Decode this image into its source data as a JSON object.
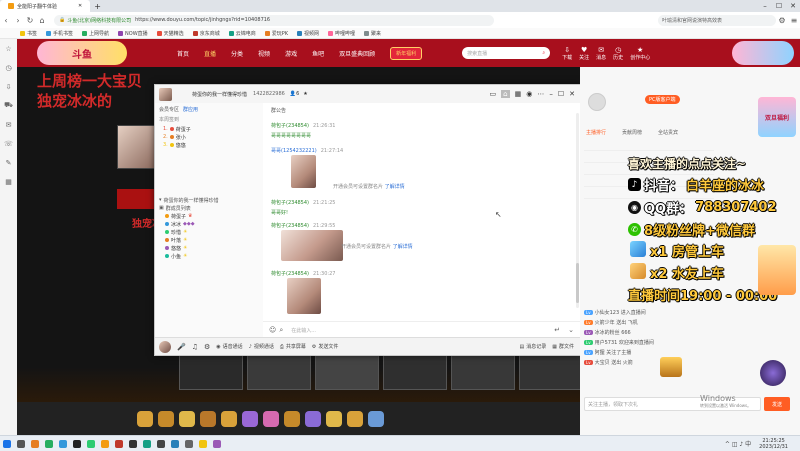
{
  "browser": {
    "tabs": [
      {
        "label": "全能阳子翻牛体验",
        "active": true
      }
    ],
    "url_site": "斗鱼(北京)网络科技有限公司",
    "url": "https://www.douyu.com/topic/jinhgngs?rid=10408716",
    "right_search": "叶瑜清和官网说演特高效表",
    "bookmarks": [
      "书签",
      "手机书签",
      "上网导航",
      "NOW直播",
      "天猫精选",
      "京东商城",
      "云锦电商",
      "爱玩PK",
      "视频网",
      "哔哩哔哩",
      "聚来"
    ]
  },
  "site": {
    "logo": "斗鱼",
    "nav": [
      "首页",
      "直播",
      "分类",
      "视频",
      "游戏",
      "鱼吧",
      "双旦盛典回顾"
    ],
    "nav_active": 1,
    "promo": "新年福利",
    "search_placeholder": "搜索直播",
    "user_icons": [
      "下载",
      "关注",
      "消息",
      "历史",
      "创作中心"
    ]
  },
  "stream": {
    "headline_line1": "上周榜一大宝贝",
    "headline_line2": "独宠冰冰的",
    "side_text": "独宠冰"
  },
  "qq": {
    "title": "荷蛋你的我一样懂得珍惜",
    "group_id": "1422822986",
    "member_count": "6",
    "left_header_a": "会员专区",
    "left_header_b": "群应用",
    "left_rank_label": "本周签到",
    "left_list": [
      "荷蛋子",
      "张小",
      "悠悠"
    ],
    "group_name_label": "荷蛋你的我一样懂得珍惜",
    "members_label": "群成员列表",
    "members": [
      "荷蛋子",
      "冰冰",
      "珍惜",
      "叶落",
      "悠悠",
      "小鱼"
    ],
    "chat_header": "群公告",
    "messages": [
      {
        "sender": "荷包子(234854)",
        "time": "21:26:31",
        "text": "哥哥哥哥哥哥哥哥"
      },
      {
        "sender": "哥哥(1254232221)",
        "time": "21:27:14",
        "text": ""
      },
      {
        "sender": "荷包子(234854)",
        "time": "21:21:25",
        "text": "哥哥好!"
      },
      {
        "sender": "荷包子(234854)",
        "time": "21:29:55",
        "text": ""
      },
      {
        "sender": "荷包子(234854)",
        "time": "21:30:27",
        "text": ""
      }
    ],
    "vip_tip": "开通会员可设置群名片",
    "vip_link": "了解详情",
    "input_placeholder": "在此输入...",
    "send_label": "发送",
    "bottom_tools": [
      "语音通话",
      "视频通话",
      "共享屏幕",
      "发送文件",
      "设置"
    ],
    "bottom_right": [
      "消息记录",
      "群文件"
    ]
  },
  "panel": {
    "pcb_label": "PC版客户端",
    "tabs": [
      "主播排行",
      "贡献周榜",
      "全站贵宾"
    ],
    "overlay": {
      "line1": "喜欢主播的点点关注~",
      "douyin_label": "抖音：",
      "douyin_name": "白羊座的冰冰",
      "qq_label": "QQ群：",
      "qq_number": "788307402",
      "fans_line": "8级粉丝牌+微信群",
      "reward1": "x1 房管上车",
      "reward2": "x2 水友上车",
      "schedule": "直播时间19:00 - 00:00"
    },
    "chat_lines": [
      "小仙女123 进入直播间",
      "火箭少年 送出 飞机",
      "冰冰的粉丝 666",
      "用户5731 欢迎来到直播间",
      "阿狸 关注了主播",
      "大宝贝 送出 火箭"
    ],
    "chat_input_placeholder": "关注主播，领取下次礼",
    "send_label": "发送",
    "promo_label": "双旦福利"
  },
  "windows_watermark": {
    "line1": "Windows",
    "line2": "转到设置以激活 Windows。"
  },
  "taskbar": {
    "time": "21:25:25",
    "date": "2023/12/31"
  },
  "colors": {
    "site_red": "#a80f1d",
    "qq_green": "#2e8b2e",
    "overlay_orange": "#ffc93c"
  }
}
